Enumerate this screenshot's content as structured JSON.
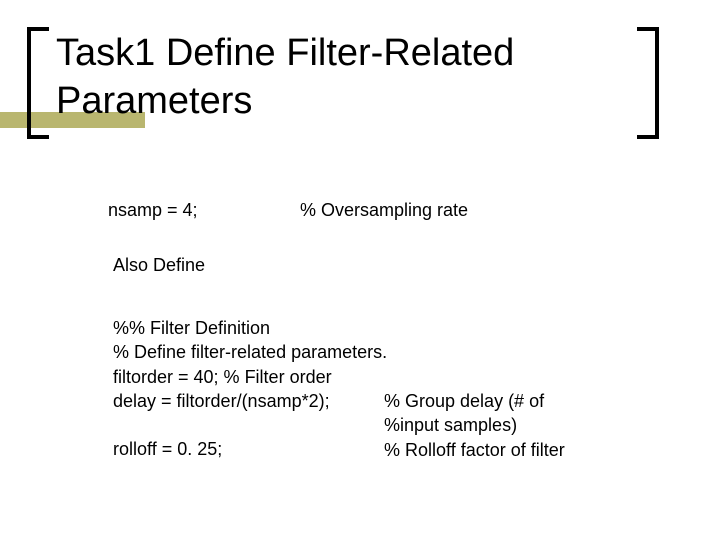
{
  "title": "Task1 Define Filter-Related Parameters",
  "row1": {
    "label": "nsamp = 4;",
    "comment": "% Oversampling rate"
  },
  "row2": {
    "label": "Also Define"
  },
  "codeblock": "%% Filter Definition\n% Define filter-related parameters.\nfiltorder = 40; % Filter order\ndelay = filtorder/(nsamp*2);\n\nrolloff = 0. 25;",
  "commentblock": "% Group delay (# of\n%input samples)\n% Rolloff factor of filter"
}
